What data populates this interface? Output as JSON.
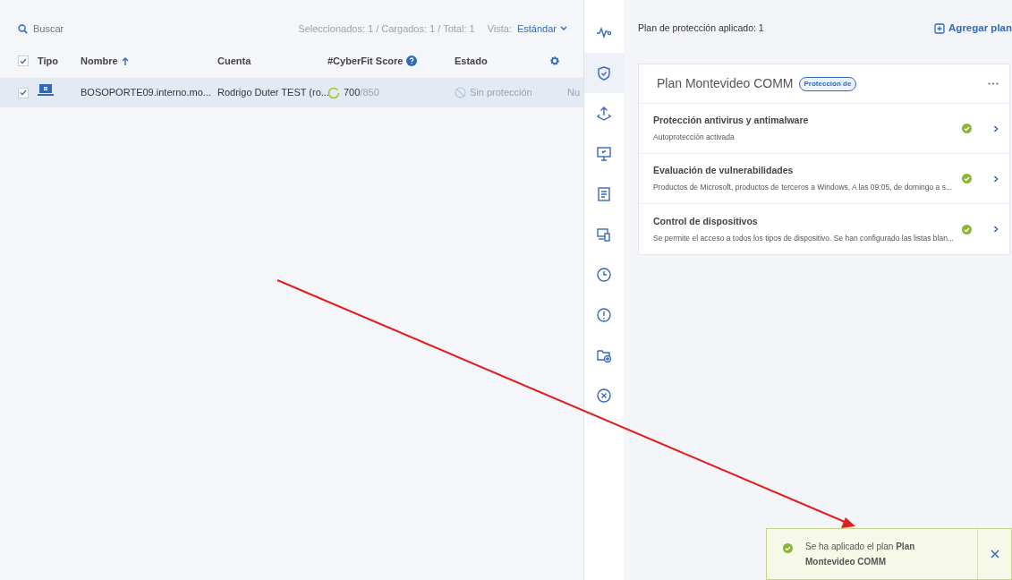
{
  "toolbar": {
    "search_placeholder": "Buscar",
    "counts": "Seleccionados: 1 / Cargados: 1 / Total: 1",
    "view_label": "Vista:",
    "view_value": "Estándar"
  },
  "table": {
    "header_checked": true,
    "columns": [
      {
        "label": "Tipo",
        "kind": "plain"
      },
      {
        "label": "Nombre",
        "kind": "sorted"
      },
      {
        "label": "Cuenta",
        "kind": "plain"
      },
      {
        "label": "#CyberFit Score",
        "kind": "help"
      },
      {
        "label": "Estado",
        "kind": "plain"
      }
    ],
    "rows": [
      {
        "checked": true,
        "selected": true,
        "name": "BOSOPORTE09.interno.mo...",
        "account": "Rodrigo Duter TEST (ro...",
        "score": "700",
        "score_max": "/850",
        "status": "Sin protección",
        "column_7": "Nu"
      }
    ]
  },
  "rail": [
    {
      "kind": "pulse",
      "selected": false
    },
    {
      "kind": "shield",
      "selected": true
    },
    {
      "kind": "upload",
      "selected": false
    },
    {
      "kind": "monitor",
      "selected": false
    },
    {
      "kind": "report",
      "selected": false
    },
    {
      "kind": "devices",
      "selected": false
    },
    {
      "kind": "clock",
      "selected": false
    },
    {
      "kind": "alert",
      "selected": false
    },
    {
      "kind": "folder",
      "selected": false
    },
    {
      "kind": "cancel",
      "selected": false
    }
  ],
  "panel": {
    "header": "Plan de protección aplicado: 1",
    "add_button": "Agregar plan",
    "plan": {
      "title": "Plan Montevideo COMM",
      "badge": "Protección de",
      "items": [
        {
          "title": "Protección antivirus y antimalware",
          "description": "Autoprotección activada",
          "ok": true
        },
        {
          "title": "Evaluación de vulnerabilidades",
          "description": "Productos de Microsoft, productos de terceros a Windows, A las 09:05, de domingo a s...",
          "ok": true
        },
        {
          "title": "Control de dispositivos",
          "description": "Se permite el acceso a todos los tipos de dispositivo. Se han configurado las listas blan...",
          "ok": true
        }
      ]
    }
  },
  "toast": {
    "message": "Se ha aplicado el plan **Plan Montevideo COMM**",
    "success": true
  }
}
